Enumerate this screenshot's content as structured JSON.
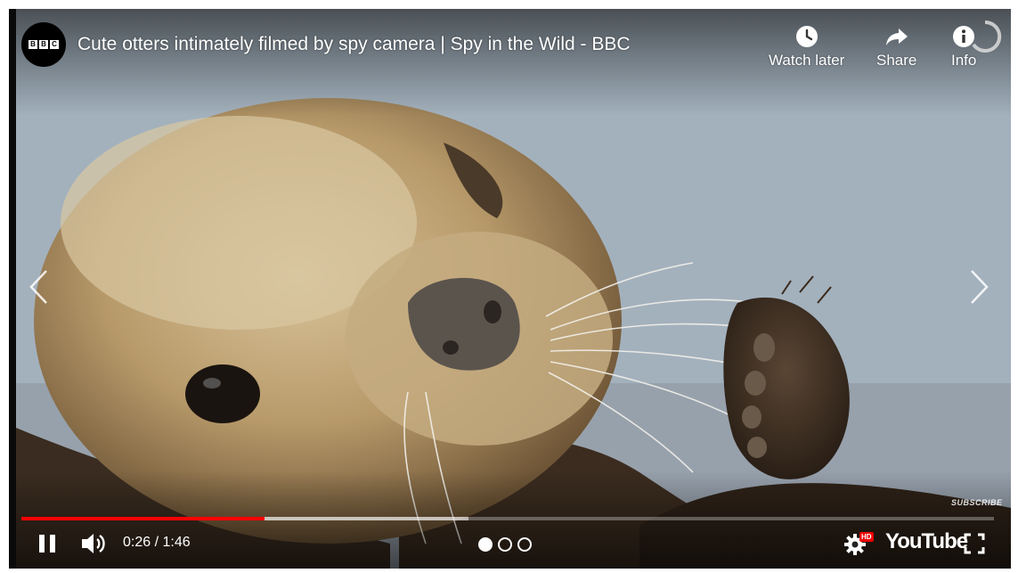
{
  "video": {
    "title": "Cute otters intimately filmed by spy camera | Spy in the Wild - BBC",
    "channel_logo_text": [
      "B",
      "B",
      "C"
    ],
    "progress_played_fraction": 0.25,
    "progress_loaded_fraction": 0.46,
    "time_display": "0:26 / 1:46",
    "subscribe_watermark": "SUBSCRIBE"
  },
  "top_actions": {
    "watch_later": {
      "label": "Watch later",
      "icon": "clock-icon"
    },
    "share": {
      "label": "Share",
      "icon": "share-arrow-icon"
    },
    "info": {
      "label": "Info",
      "icon": "info-icon"
    }
  },
  "controls": {
    "play_state_icon": "pause-icon",
    "volume_icon": "volume-icon",
    "settings_icon": "gear-icon",
    "hd_badge": "HD",
    "youtube_logo": "YouTube",
    "fullscreen_icon": "fullscreen-icon",
    "pagination": {
      "count": 3,
      "active_index": 0
    }
  },
  "colors": {
    "progress_played": "#ff0000",
    "hd_badge": "#e00000",
    "overlay_text": "#ffffff"
  }
}
